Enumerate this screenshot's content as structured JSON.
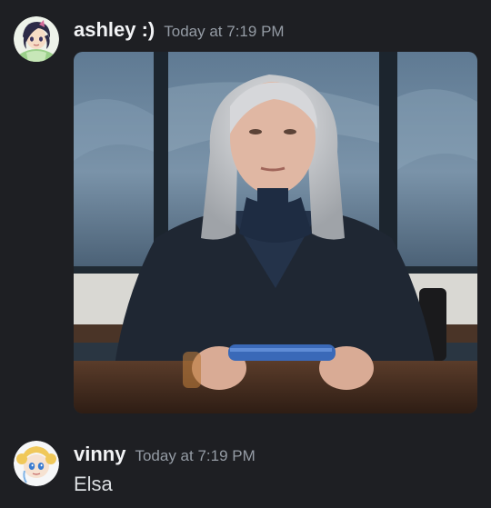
{
  "messages": [
    {
      "username": "ashley :)",
      "timestamp": "Today at 7:19 PM",
      "avatar_icon": "anime-avatar-icon",
      "attachment": "image-attachment",
      "username_color": "#f2f3f5"
    },
    {
      "username": "vinny",
      "timestamp": "Today at 7:19 PM",
      "avatar_icon": "cartoon-avatar-icon",
      "content": "Elsa",
      "username_color": "#f2f3f5"
    }
  ],
  "colors": {
    "background": "#1e1f23",
    "timestamp": "#949ba4",
    "text": "#dbdee1"
  }
}
